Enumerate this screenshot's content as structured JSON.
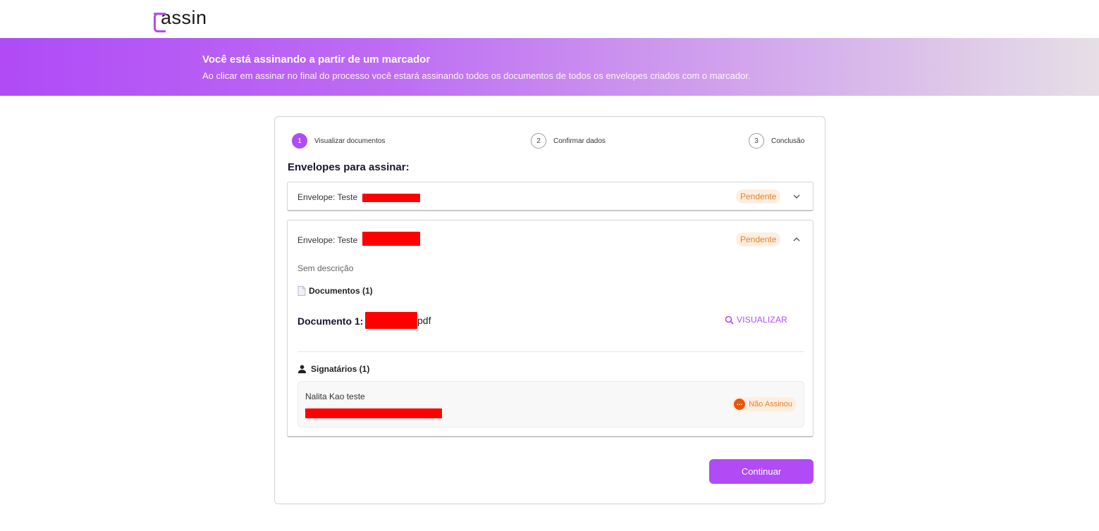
{
  "brand": {
    "logo_text": "assin",
    "accent": "#b04bf6"
  },
  "banner": {
    "title": "Você está assinando a partir de um marcador",
    "subtitle": "Ao clicar em assinar no final do processo você estará assinando todos os documentos de todos os envelopes criados com o marcador."
  },
  "stepper": {
    "steps": [
      {
        "number": "1",
        "label": "Visualizar documentos",
        "active": true
      },
      {
        "number": "2",
        "label": "Confirmar dados",
        "active": false
      },
      {
        "number": "3",
        "label": "Conclusão",
        "active": false
      }
    ]
  },
  "main": {
    "section_title": "Envelopes para assinar:",
    "envelopes": [
      {
        "label": "Envelope: Teste",
        "status": "Pendente",
        "expanded": false
      },
      {
        "label": "Envelope: Teste",
        "status": "Pendente",
        "expanded": true,
        "description": "Sem descrição",
        "documents_header": "Documentos (1)",
        "document": {
          "label": "Documento 1:",
          "ext": "pdf",
          "action": "VISUALIZAR"
        },
        "signers_header": "Signatários (1)",
        "signer": {
          "name": "Nalita Kao teste",
          "status": "Não Assinou"
        }
      }
    ],
    "continue_label": "Continuar"
  },
  "icons": {
    "chevron_down": "chevron-down-icon",
    "chevron_up": "chevron-up-icon",
    "document": "document-icon",
    "search": "search-icon",
    "user": "user-icon",
    "more": "more-dots-icon"
  }
}
